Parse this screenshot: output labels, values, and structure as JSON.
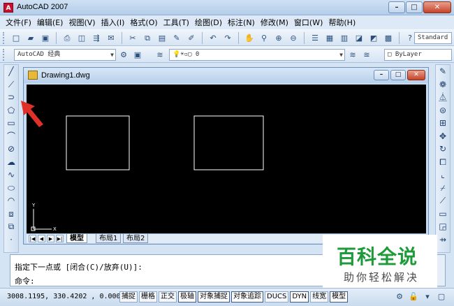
{
  "app": {
    "title": "AutoCAD 2007",
    "icon_letter": "A"
  },
  "menu": [
    "文件(F)",
    "编辑(E)",
    "视图(V)",
    "插入(I)",
    "格式(O)",
    "工具(T)",
    "绘图(D)",
    "标注(N)",
    "修改(M)",
    "窗口(W)",
    "帮助(H)"
  ],
  "toolbar1": {
    "text_style": "Standard"
  },
  "toolbar2": {
    "workspace": "AutoCAD 经典",
    "layer": "0",
    "linetype": "ByLayer"
  },
  "drawing": {
    "title": "Drawing1.dwg",
    "ucs_x": "X",
    "ucs_y": "Y",
    "tabs": [
      "模型",
      "布局1",
      "布局2"
    ]
  },
  "command": {
    "line1": "指定下一点或 [闭合(C)/放弃(U)]:",
    "line2": "命令:"
  },
  "status": {
    "coords": "3008.1195, 330.4202 , 0.0000",
    "buttons": [
      "捕捉",
      "栅格",
      "正交",
      "极轴",
      "对象捕捉",
      "对象追踪",
      "DUCS",
      "DYN",
      "线宽",
      "模型"
    ]
  },
  "watermark": {
    "brand": "百科全说",
    "tagline": "助你轻松解决"
  },
  "colors": {
    "canvas": "#000000",
    "watermark_green": "#1f9a3a",
    "annotation_arrow": "#e0302a"
  }
}
